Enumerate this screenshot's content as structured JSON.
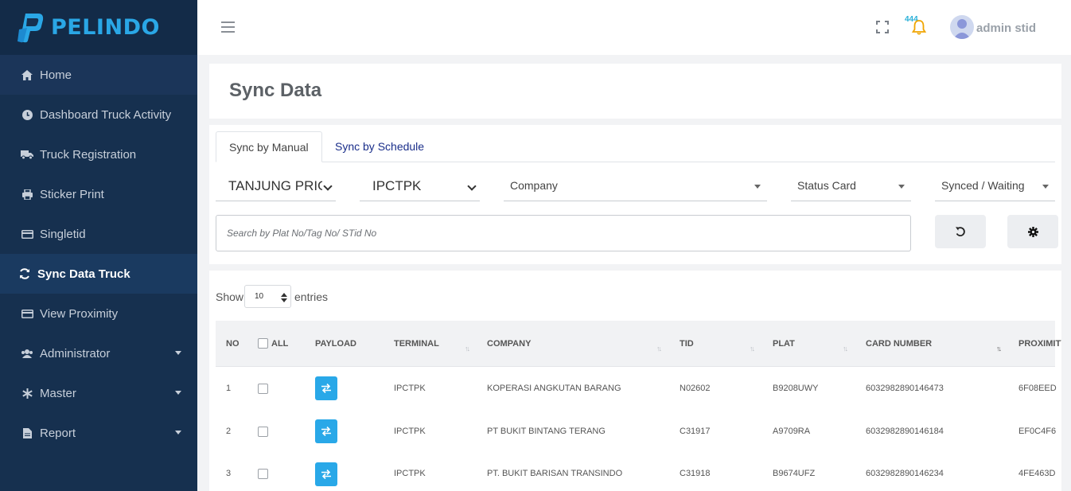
{
  "brand": {
    "name": "PELINDO"
  },
  "sidebar": {
    "items": [
      {
        "label": "Home",
        "icon": "home-icon"
      },
      {
        "label": "Dashboard Truck Activity",
        "icon": "clock-icon"
      },
      {
        "label": "Truck Registration",
        "icon": "truck-icon"
      },
      {
        "label": "Sticker Print",
        "icon": "printer-icon"
      },
      {
        "label": "Singletid",
        "icon": "card-icon"
      },
      {
        "label": "Sync Data Truck",
        "icon": "sync-icon",
        "active": true
      },
      {
        "label": "View Proximity",
        "icon": "card-icon"
      },
      {
        "label": "Administrator",
        "icon": "users-icon",
        "has_submenu": true
      },
      {
        "label": "Master",
        "icon": "asterisk-icon",
        "has_submenu": true
      },
      {
        "label": "Report",
        "icon": "file-icon",
        "has_submenu": true
      }
    ]
  },
  "header": {
    "notification_count": "444",
    "username": "admin stid"
  },
  "page": {
    "title": "Sync Data"
  },
  "tabs": [
    {
      "label": "Sync by Manual",
      "active": true
    },
    {
      "label": "Sync by Schedule",
      "active": false
    }
  ],
  "filters": {
    "port": "TANJUNG PRIOK",
    "terminal": "IPCTPK",
    "company": "Company",
    "status_card": "Status Card",
    "sync_status": "Synced / Waiting"
  },
  "search": {
    "placeholder": "Search by Plat No/Tag No/ STid No"
  },
  "table": {
    "show_label": "Show",
    "entries_value": "10",
    "entries_label": "entries",
    "all_label": "ALL",
    "columns": [
      "NO",
      "PAYLOAD",
      "TERMINAL",
      "COMPANY",
      "TID",
      "PLAT",
      "CARD NUMBER",
      "PROXIMITY"
    ],
    "rows": [
      {
        "no": "1",
        "terminal": "IPCTPK",
        "company": "KOPERASI ANGKUTAN BARANG",
        "tid": "N02602",
        "plat": "B9208UWY",
        "card_number": "6032982890146473",
        "proximity": "6F08EED"
      },
      {
        "no": "2",
        "terminal": "IPCTPK",
        "company": "PT BUKIT BINTANG TERANG",
        "tid": "C31917",
        "plat": "A9709RA",
        "card_number": "6032982890146184",
        "proximity": "EF0C4F6"
      },
      {
        "no": "3",
        "terminal": "IPCTPK",
        "company": "PT. BUKIT BARISAN TRANSINDO",
        "tid": "C31918",
        "plat": "B9674UFZ",
        "card_number": "6032982890146234",
        "proximity": "4FE463D"
      }
    ]
  },
  "colors": {
    "sidebar_bg": "#16304f",
    "sidebar_active": "#1a3a60",
    "brand_blue": "#2aa7e6",
    "payload_button": "#29a8e8",
    "tab_link": "#1a2e8a"
  }
}
